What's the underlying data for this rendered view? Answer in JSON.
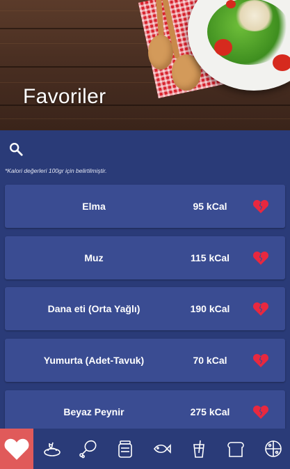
{
  "header": {
    "title": "Favoriler"
  },
  "search": {
    "icon": "search-icon"
  },
  "note": "*Kalori değerleri 100gr için belirtilmiştir.",
  "items": [
    {
      "name": "Elma",
      "kcal": "95 kCal"
    },
    {
      "name": "Muz",
      "kcal": "115 kCal"
    },
    {
      "name": "Dana eti (Orta Yağlı)",
      "kcal": "190 kCal"
    },
    {
      "name": "Yumurta (Adet-Tavuk)",
      "kcal": "70 kCal"
    },
    {
      "name": "Beyaz Peynir",
      "kcal": "275 kCal"
    }
  ],
  "nav": {
    "items": [
      "heart-icon",
      "dairy-icon",
      "chicken-leg-icon",
      "jar-icon",
      "fish-icon",
      "drink-icon",
      "bread-icon",
      "pizza-icon"
    ]
  },
  "colors": {
    "background": "#2a3b78",
    "row": "#3a4c92",
    "heart": "#e8283f",
    "nav_active": "#e05a5a",
    "text": "#ffffff"
  }
}
